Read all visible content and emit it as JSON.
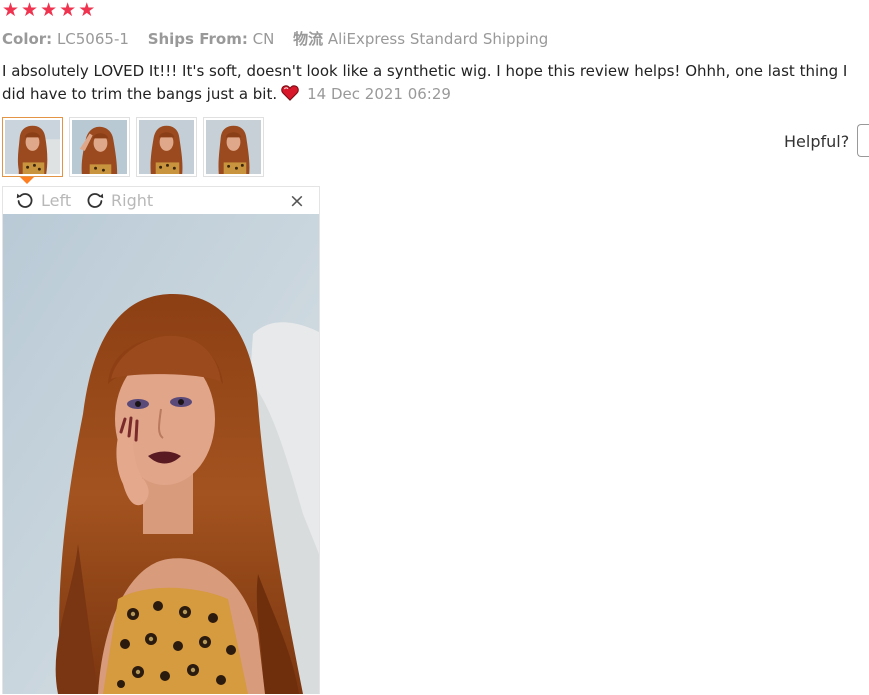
{
  "rating": {
    "stars": 5,
    "star_glyph": "★",
    "color": "#f0334f"
  },
  "meta": {
    "color_label": "Color:",
    "color_value": "LC5065-1",
    "ships_label": "Ships From:",
    "ships_value": "CN",
    "logistics_label": "物流",
    "logistics_value": "AliExpress Standard Shipping"
  },
  "review": {
    "text": "I absolutely LOVED It!!! It's soft, doesn't look like a synthetic wig. I hope this review helps! Ohhh, one last thing I did have to trim the bangs just a bit.",
    "emoji": "heart-icon",
    "date": "14 Dec 2021 06:29"
  },
  "thumbnails": {
    "count": 4,
    "active_index": 0,
    "active_color": "#e39545"
  },
  "helpful": {
    "label": "Helpful?"
  },
  "viewer": {
    "rotate_left_label": "Left",
    "rotate_right_label": "Right",
    "close_glyph": "×"
  }
}
